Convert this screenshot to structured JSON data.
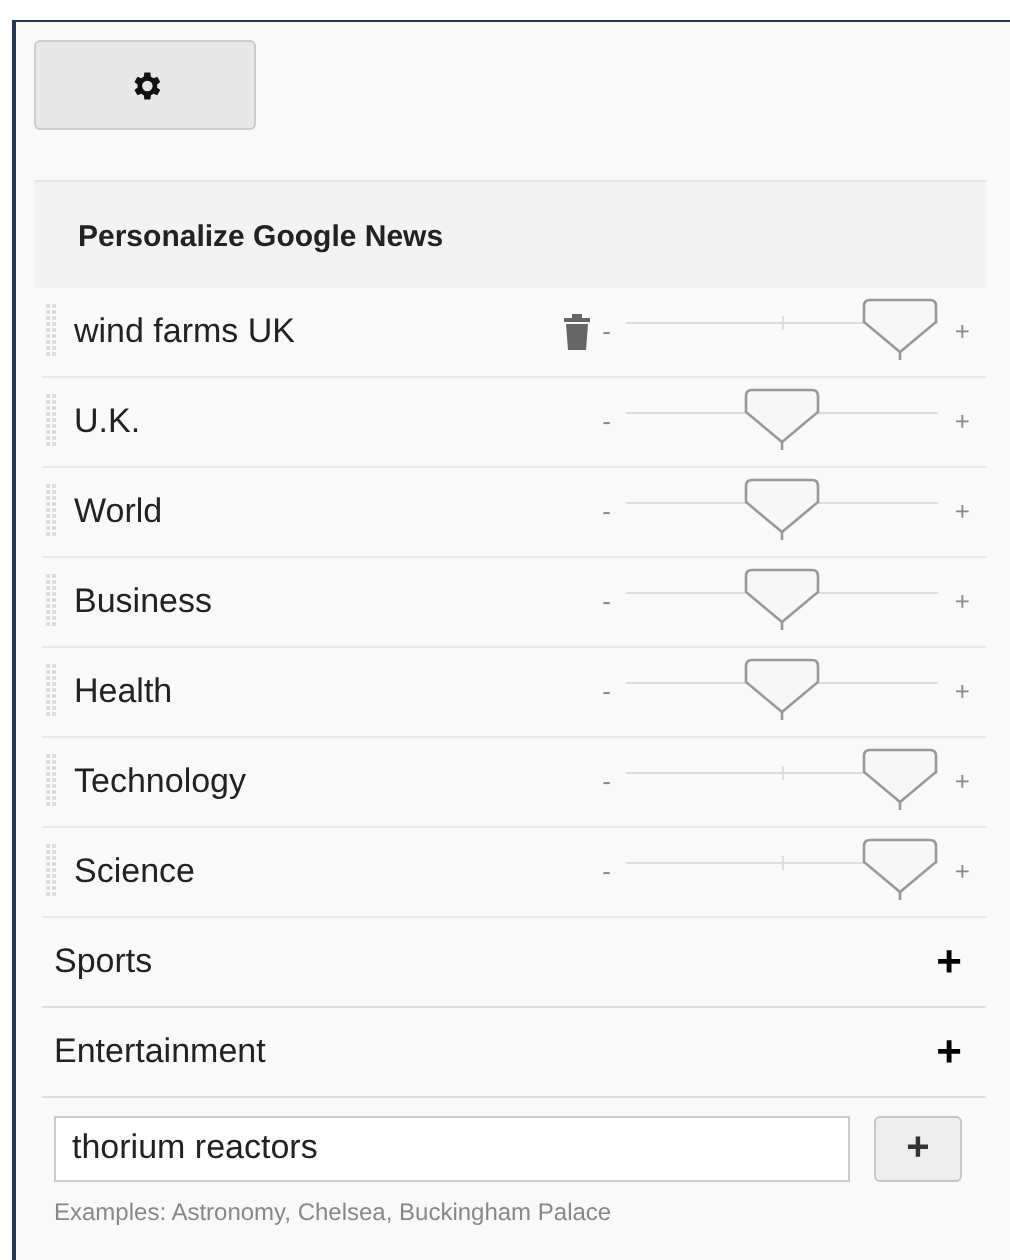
{
  "panel_title": "Personalize Google News",
  "topics": [
    {
      "kind": "slider",
      "label": "wind farms UK",
      "removable": true,
      "minus": "-",
      "plus": "+",
      "level": 1
    },
    {
      "kind": "slider",
      "label": "U.K.",
      "removable": false,
      "minus": "-",
      "plus": "+",
      "level": 0.5
    },
    {
      "kind": "slider",
      "label": "World",
      "removable": false,
      "minus": "-",
      "plus": "+",
      "level": 0.5
    },
    {
      "kind": "slider",
      "label": "Business",
      "removable": false,
      "minus": "-",
      "plus": "+",
      "level": 0.5
    },
    {
      "kind": "slider",
      "label": "Health",
      "removable": false,
      "minus": "-",
      "plus": "+",
      "level": 0.5
    },
    {
      "kind": "slider",
      "label": "Technology",
      "removable": false,
      "minus": "-",
      "plus": "+",
      "level": 1
    },
    {
      "kind": "slider",
      "label": "Science",
      "removable": false,
      "minus": "-",
      "plus": "+",
      "level": 1
    },
    {
      "kind": "add",
      "label": "Sports",
      "add": "+"
    },
    {
      "kind": "add",
      "label": "Entertainment",
      "add": "+"
    }
  ],
  "custom_topic": {
    "value": "thorium reactors",
    "add_button": "+",
    "hint": "Examples: Astronomy, Chelsea, Buckingham Palace"
  }
}
